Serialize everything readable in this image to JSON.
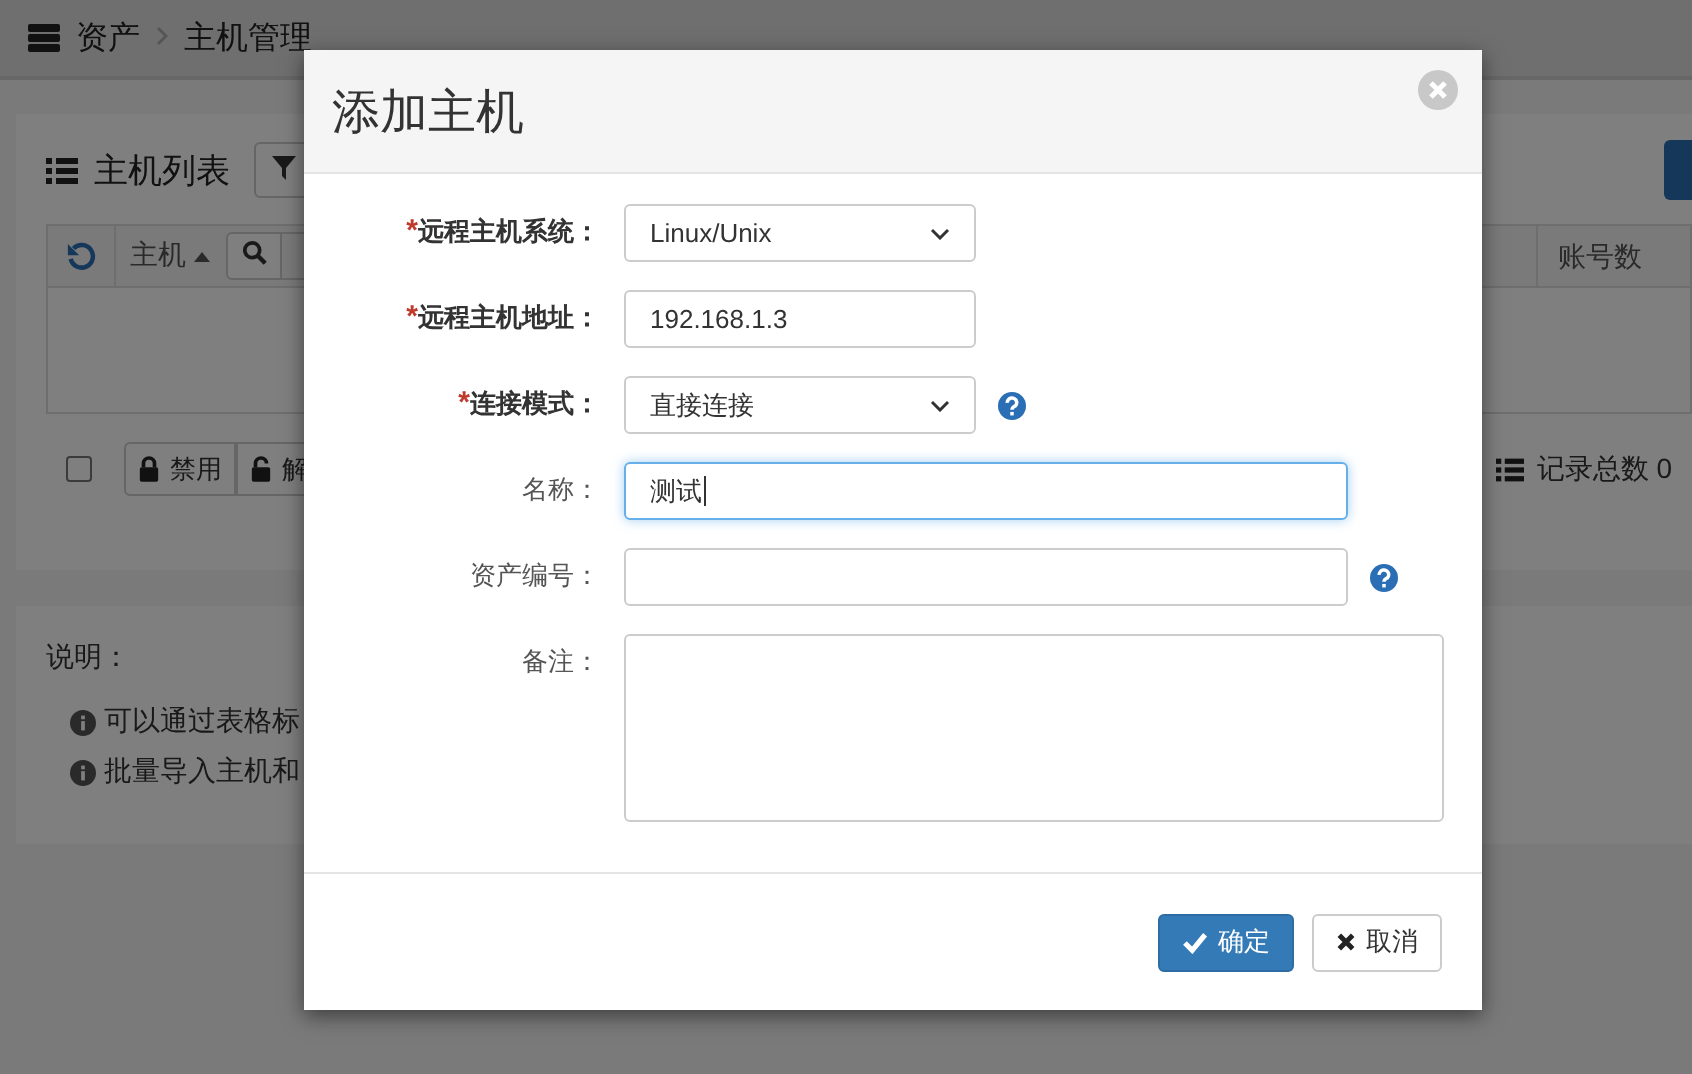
{
  "breadcrumb": {
    "items": [
      "资产",
      "主机管理"
    ]
  },
  "host_list": {
    "title": "主机列表",
    "columns": [
      "主机",
      "账号数"
    ],
    "select_all": {
      "checked": false
    },
    "actions": [
      "禁用",
      "解"
    ],
    "record_count": "记录总数 0"
  },
  "notes": {
    "title": "说明：",
    "items": [
      "可以通过表格标",
      "批量导入主机和"
    ]
  },
  "dialog": {
    "title": "添加主机",
    "fields": [
      {
        "label": "远程主机系统：",
        "mark": "*",
        "kind": "select",
        "value": "Linux/Unix",
        "help": false,
        "focused": false
      },
      {
        "label": "远程主机地址：",
        "mark": "*",
        "kind": "input",
        "value": "192.168.1.3",
        "help": false,
        "focused": false
      },
      {
        "label": "连接模式：",
        "mark": "*",
        "kind": "select",
        "value": "直接连接",
        "help": true,
        "focused": false
      },
      {
        "label": "名称：",
        "kind": "input",
        "value": "测试",
        "help": false,
        "focused": true
      },
      {
        "label": "资产编号：",
        "kind": "input",
        "help": true,
        "focused": false
      },
      {
        "label": "备注：",
        "kind": "textarea",
        "help": false,
        "focused": false
      }
    ],
    "buttons": [
      {
        "label": "确定",
        "kind": "primary"
      },
      {
        "label": "取消",
        "kind": "default"
      }
    ]
  }
}
